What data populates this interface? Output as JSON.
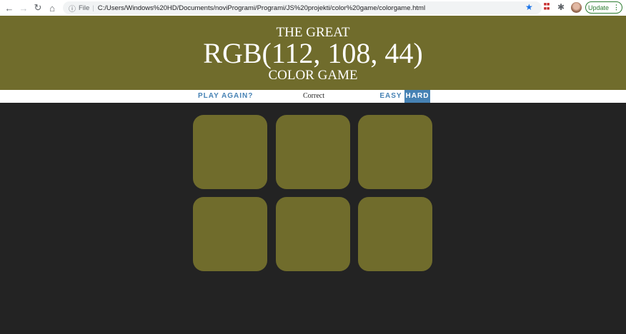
{
  "browser": {
    "back_icon": "arrow-left-icon",
    "forward_icon": "arrow-right-icon",
    "reload_icon": "reload-icon",
    "home_icon": "home-icon",
    "scheme_label": "File",
    "url": "C:/Users/Windows%20HD/Documents/noviProgrami/Programi/JS%20projekti/color%20game/colorgame.html",
    "update_label": "Update"
  },
  "header": {
    "line1": "THE GREAT",
    "rgb": "RGB(112, 108, 44)",
    "line3": "COLOR GAME",
    "background": "#706c2c"
  },
  "stripe": {
    "play_again": "PLAY AGAIN?",
    "message": "Correct",
    "easy": "EASY",
    "hard": "HARD",
    "selected_mode": "HARD",
    "accent": "#4682b4"
  },
  "squares": [
    {
      "color": "#706c2c"
    },
    {
      "color": "#706c2c"
    },
    {
      "color": "#706c2c"
    },
    {
      "color": "#706c2c"
    },
    {
      "color": "#706c2c"
    },
    {
      "color": "#706c2c"
    }
  ],
  "page_background": "#232323"
}
